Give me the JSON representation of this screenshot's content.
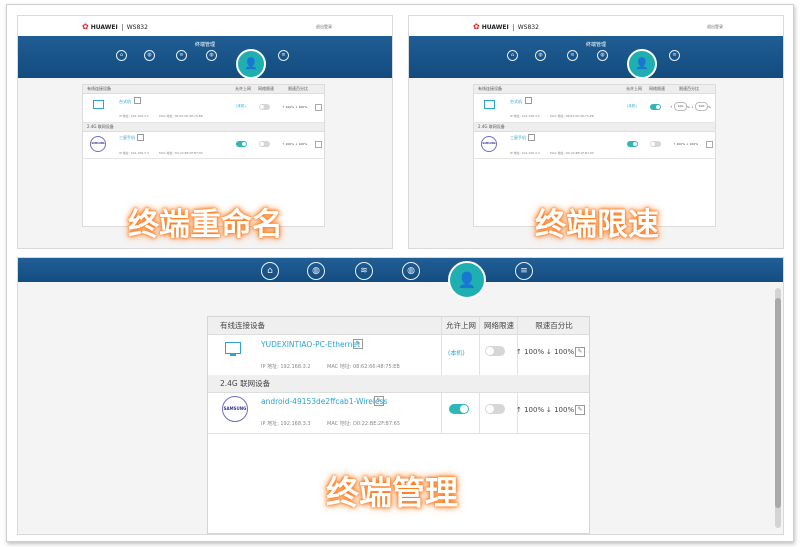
{
  "brand": {
    "vendor": "HUAWEI",
    "model": "WS832",
    "exit": "退出登录"
  },
  "small_title": "终端管理",
  "captions": {
    "rename": "终端重命名",
    "limit": "终端限速",
    "manage": "终端管理"
  },
  "table": {
    "wired_header": "有线连接设备",
    "wifi_header": "2.4G 联网设备",
    "col_allow": "允许上网",
    "col_limit": "网络限速",
    "col_percent": "限速百分比"
  },
  "small_rows": {
    "wired_name": "台式机",
    "wired_ip": "IP 地址: 192.168.3.2",
    "wired_mac": "MAC 地址: 08:62:66:48:75:EB",
    "wifi_name": "三星手机",
    "wifi_ip": "IP 地址: 192.168.3.3",
    "wifi_mac": "MAC 地址: D0:22:BE:2F:B7:65",
    "badge": "(本机)",
    "limit_up": "100",
    "limit_down": "100",
    "pct": "%"
  },
  "devices": [
    {
      "name": "YUDEXINTIAO-PC-Ethernet",
      "ip": "IP 地址: 192.168.3.2",
      "mac": "MAC 地址: 08:62:66:48:75:EB",
      "badge": "(本机)",
      "up": "↑ 100%",
      "down": "↓ 100%"
    },
    {
      "name": "android-49153de2ffcab1-Wireless",
      "ip": "IP 地址: 192.168.3.3",
      "mac": "MAC 地址: D0:22:BE:2F:B7:65",
      "up": "↑ 100%",
      "down": "↓ 100%",
      "icon_text": "SAMSUNG"
    }
  ],
  "icons": [
    "home-icon",
    "globe-icon",
    "wifi-icon",
    "globe-settings-icon",
    "user-icon",
    "menu-icon"
  ],
  "colors": {
    "nav": "#1a5a91",
    "accent": "#1faeb1",
    "link": "#2aa3d6",
    "glow": "#ff7a1a"
  }
}
